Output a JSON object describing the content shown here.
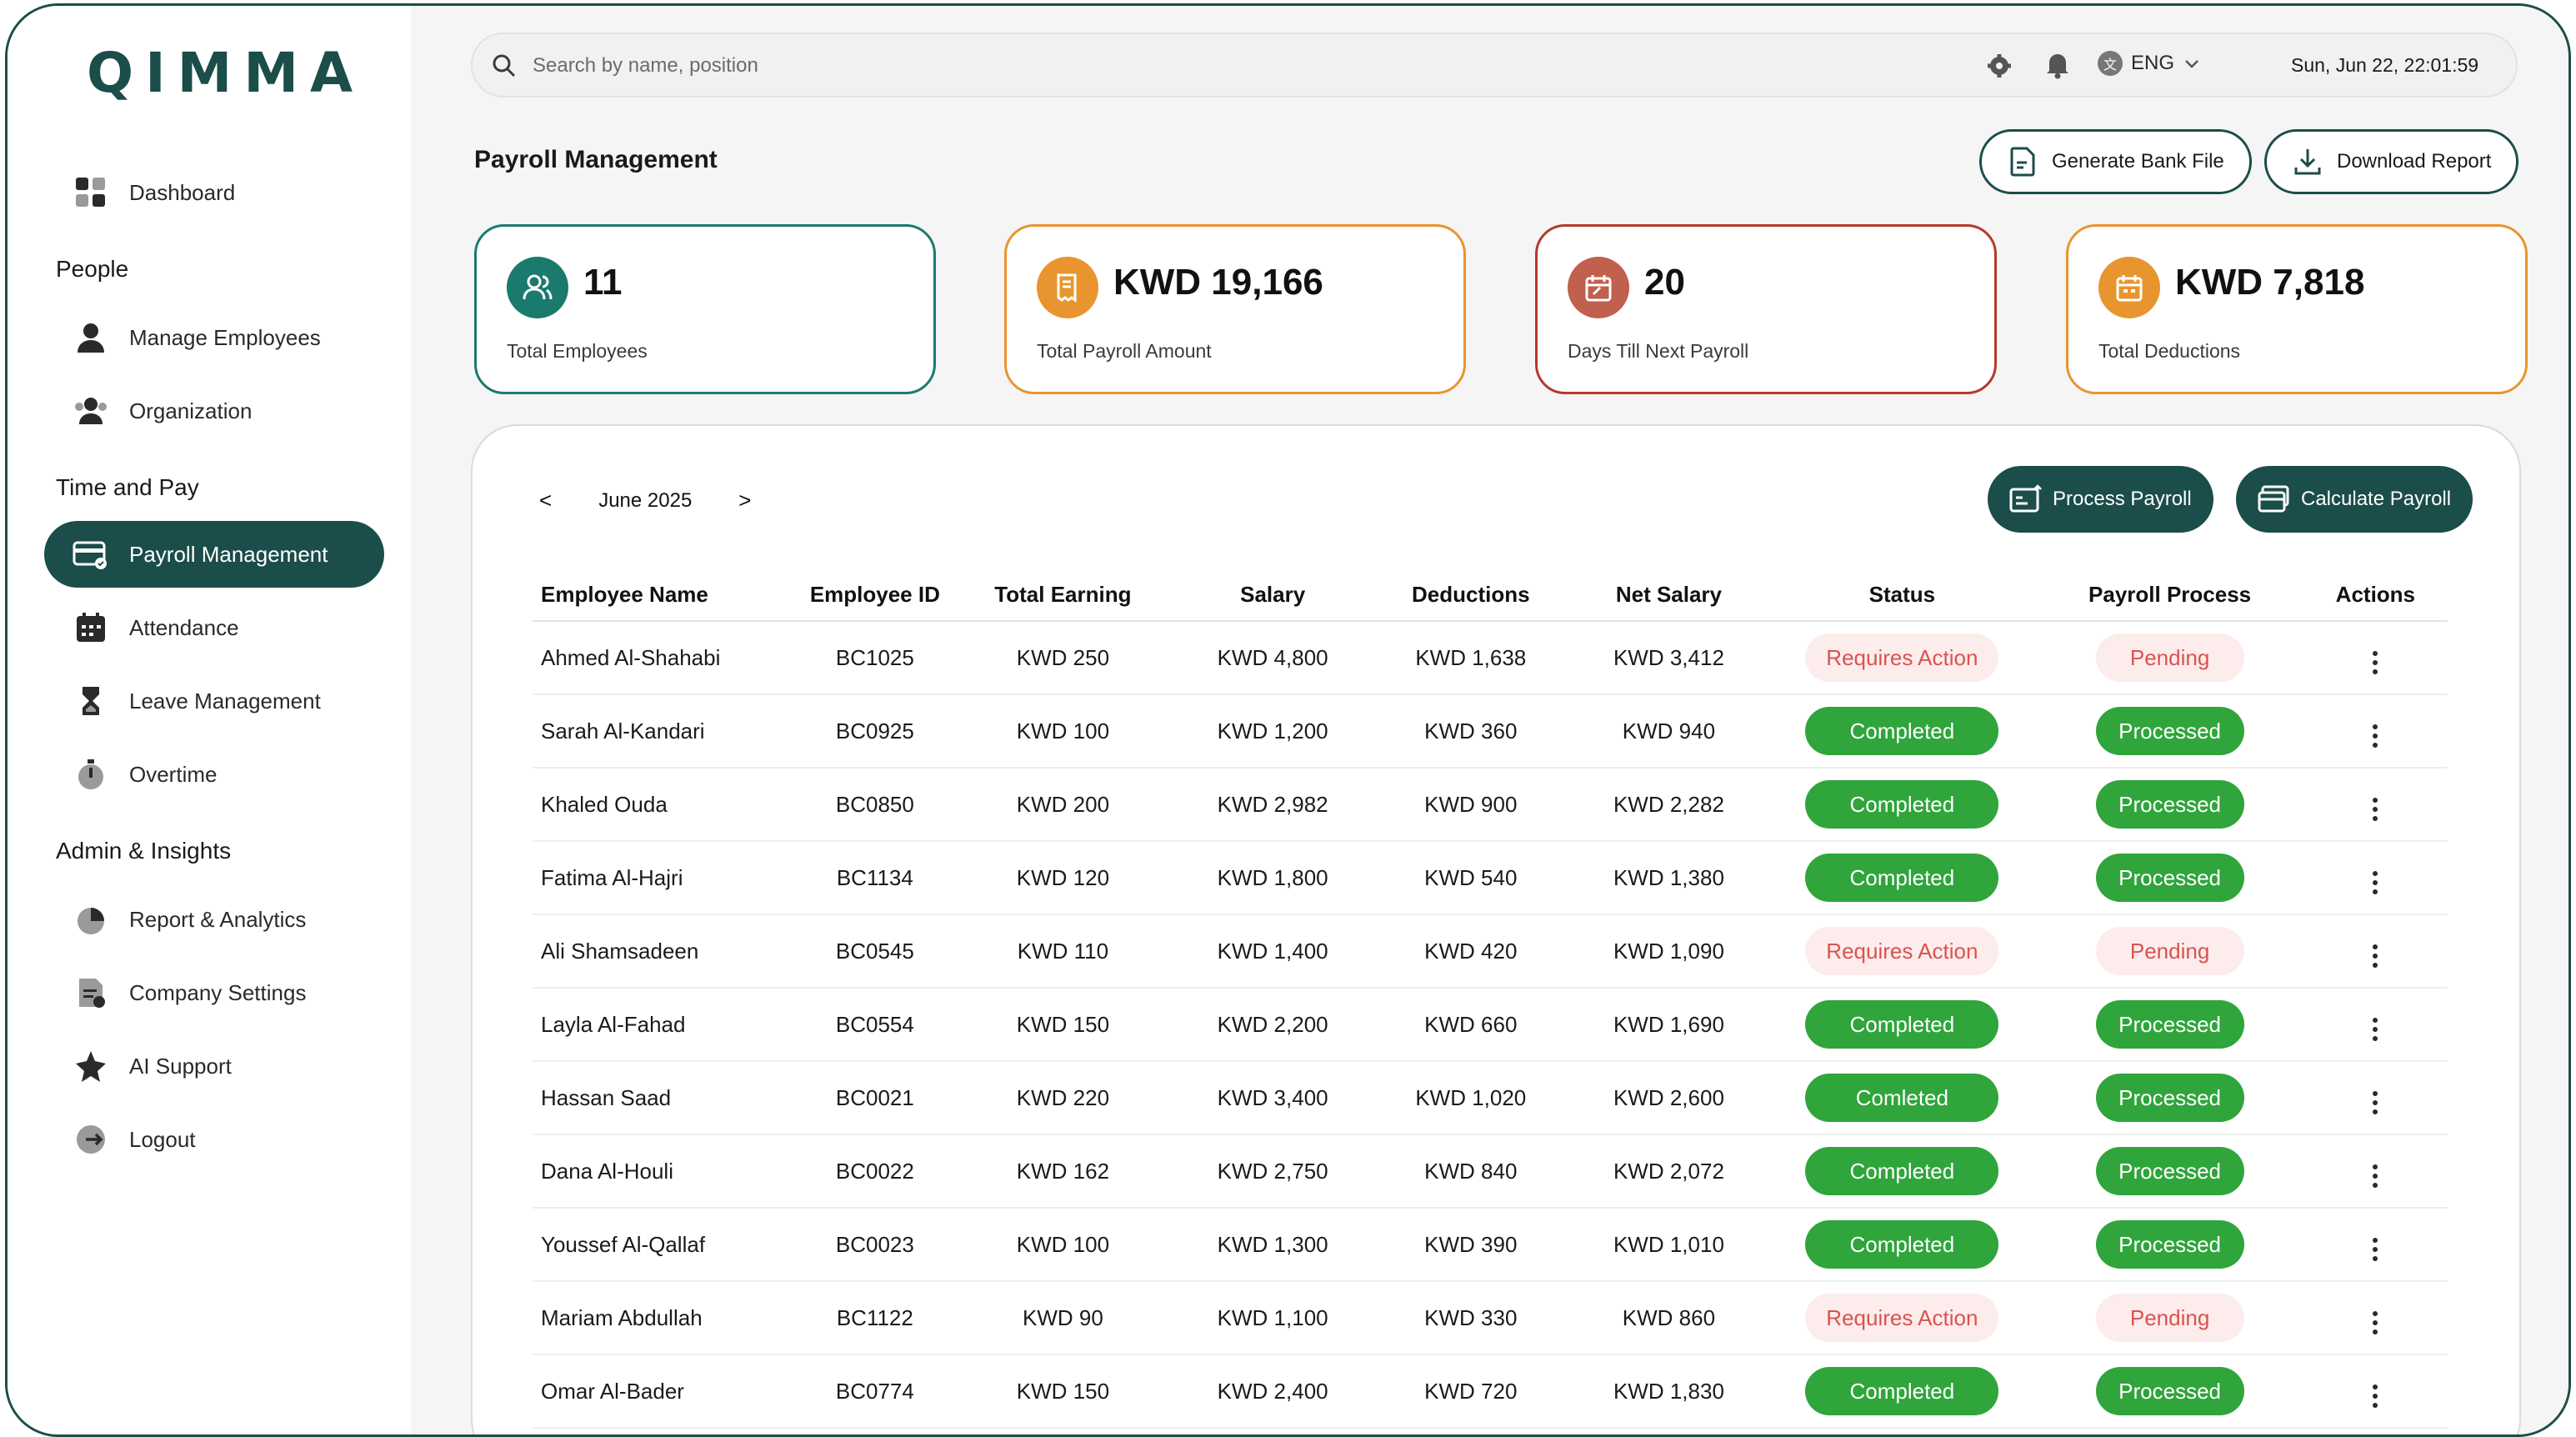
{
  "brand": {
    "logo_text": "QIMMA",
    "accent": "#1b4d4a"
  },
  "sidebar": {
    "dashboard": "Dashboard",
    "sections": {
      "people": "People",
      "time_pay": "Time and Pay",
      "admin": "Admin & Insights"
    },
    "items": {
      "manage_employees": "Manage Employees",
      "organization": "Organization",
      "payroll": "Payroll Management",
      "attendance": "Attendance",
      "leave": "Leave Management",
      "overtime": "Overtime",
      "reports": "Report & Analytics",
      "company_settings": "Company Settings",
      "ai_support": "AI Support",
      "logout": "Logout"
    }
  },
  "topbar": {
    "search_placeholder": "Search by name, position",
    "language": "ENG",
    "datetime": "Sun, Jun 22, 22:01:59"
  },
  "page": {
    "title": "Payroll Management",
    "generate_bank_file": "Generate Bank File",
    "download_report": "Download Report"
  },
  "stats": [
    {
      "value": "11",
      "label": "Total Employees",
      "color": "#1b7a6e"
    },
    {
      "value": "KWD 19,166",
      "label": "Total Payroll Amount",
      "color": "#e8952f"
    },
    {
      "value": "20",
      "label": "Days Till Next Payroll",
      "color": "#c0604d"
    },
    {
      "value": "KWD 7,818",
      "label": "Total Deductions",
      "color": "#e8952f"
    }
  ],
  "panel": {
    "prev": "<",
    "month": "June 2025",
    "next": ">",
    "process_payroll": "Process Payroll",
    "calculate_payroll": "Calculate Payroll"
  },
  "table": {
    "headers": [
      "Employee Name",
      "Employee ID",
      "Total Earning",
      "Salary",
      "Deductions",
      "Net Salary",
      "Status",
      "Payroll Process",
      "Actions"
    ],
    "rows": [
      [
        "Ahmed Al-Shahabi",
        "BC1025",
        "KWD 250",
        "KWD 4,800",
        "KWD 1,638",
        "KWD 3,412",
        "Requires Action",
        "Pending"
      ],
      [
        "Sarah Al-Kandari",
        "BC0925",
        "KWD 100",
        "KWD 1,200",
        "KWD 360",
        "KWD 940",
        "Completed",
        "Processed"
      ],
      [
        "Khaled Ouda",
        "BC0850",
        "KWD 200",
        "KWD 2,982",
        "KWD 900",
        "KWD 2,282",
        "Completed",
        "Processed"
      ],
      [
        "Fatima Al-Hajri",
        "BC1134",
        "KWD 120",
        "KWD 1,800",
        "KWD 540",
        "KWD 1,380",
        "Completed",
        "Processed"
      ],
      [
        "Ali Shamsadeen",
        "BC0545",
        "KWD 110",
        "KWD 1,400",
        "KWD 420",
        "KWD 1,090",
        "Requires Action",
        "Pending"
      ],
      [
        "Layla Al-Fahad",
        "BC0554",
        "KWD 150",
        "KWD 2,200",
        "KWD 660",
        "KWD 1,690",
        "Completed",
        "Processed"
      ],
      [
        "Hassan Saad",
        "BC0021",
        "KWD 220",
        "KWD 3,400",
        "KWD 1,020",
        "KWD 2,600",
        "Comleted",
        "Processed"
      ],
      [
        "Dana Al-Houli",
        "BC0022",
        "KWD 162",
        "KWD 2,750",
        "KWD 840",
        "KWD 2,072",
        "Completed",
        "Processed"
      ],
      [
        "Youssef Al-Qallaf",
        "BC0023",
        "KWD 100",
        "KWD 1,300",
        "KWD 390",
        "KWD 1,010",
        "Completed",
        "Processed"
      ],
      [
        "Mariam Abdullah",
        "BC1122",
        "KWD 90",
        "KWD 1,100",
        "KWD 330",
        "KWD 860",
        "Requires Action",
        "Pending"
      ],
      [
        "Omar Al-Bader",
        "BC0774",
        "KWD 150",
        "KWD 2,400",
        "KWD 720",
        "KWD 1,830",
        "Completed",
        "Processed"
      ]
    ]
  },
  "status_colors": {
    "completed": "#2fa53b",
    "requires_action": "#d9534f"
  }
}
